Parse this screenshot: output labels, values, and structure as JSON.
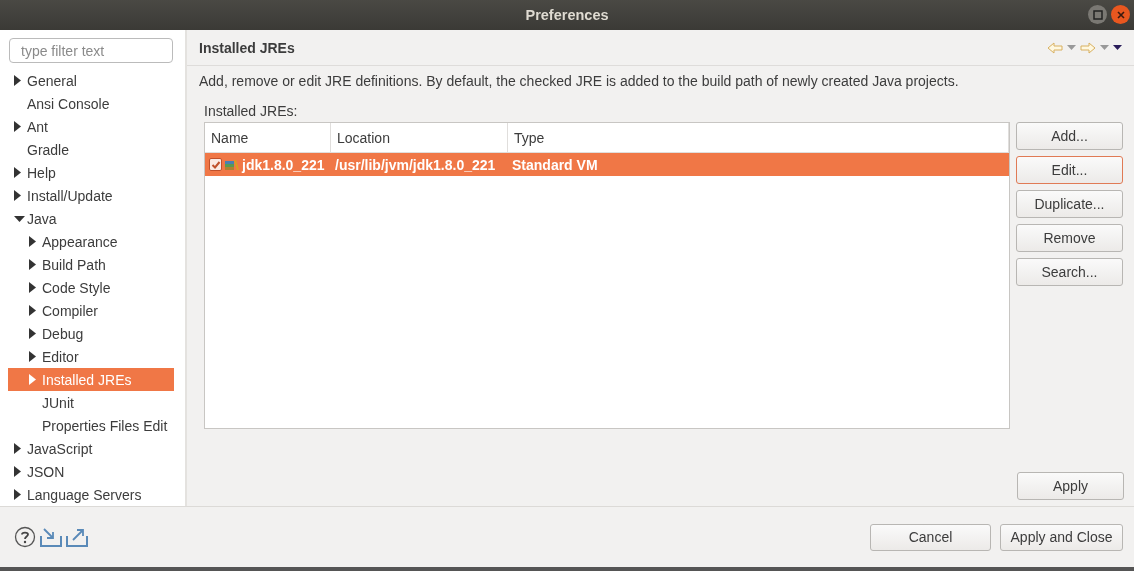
{
  "window": {
    "title": "Preferences"
  },
  "filter": {
    "placeholder": "type filter text"
  },
  "tree": [
    {
      "label": "General",
      "kind": "folder",
      "expanded": false,
      "selected": false
    },
    {
      "label": "Ansi Console",
      "kind": "leaf",
      "selected": false
    },
    {
      "label": "Ant",
      "kind": "folder",
      "expanded": false,
      "selected": false
    },
    {
      "label": "Gradle",
      "kind": "leaf",
      "selected": false
    },
    {
      "label": "Help",
      "kind": "folder",
      "expanded": false,
      "selected": false
    },
    {
      "label": "Install/Update",
      "kind": "folder",
      "expanded": false,
      "selected": false
    },
    {
      "label": "Java",
      "kind": "folder",
      "expanded": true,
      "selected": false,
      "children": [
        {
          "label": "Appearance",
          "kind": "folder",
          "expanded": false,
          "selected": false
        },
        {
          "label": "Build Path",
          "kind": "folder",
          "expanded": false,
          "selected": false
        },
        {
          "label": "Code Style",
          "kind": "folder",
          "expanded": false,
          "selected": false
        },
        {
          "label": "Compiler",
          "kind": "folder",
          "expanded": false,
          "selected": false
        },
        {
          "label": "Debug",
          "kind": "folder",
          "expanded": false,
          "selected": false
        },
        {
          "label": "Editor",
          "kind": "folder",
          "expanded": false,
          "selected": false
        },
        {
          "label": "Installed JREs",
          "kind": "folder",
          "expanded": false,
          "selected": true
        },
        {
          "label": "JUnit",
          "kind": "leaf",
          "selected": false
        },
        {
          "label": "Properties Files Edit",
          "kind": "leaf",
          "selected": false
        }
      ]
    },
    {
      "label": "JavaScript",
      "kind": "folder",
      "expanded": false,
      "selected": false
    },
    {
      "label": "JSON",
      "kind": "folder",
      "expanded": false,
      "selected": false
    },
    {
      "label": "Language Servers",
      "kind": "folder",
      "expanded": false,
      "selected": false
    }
  ],
  "page": {
    "title": "Installed JREs",
    "description": "Add, remove or edit JRE definitions. By default, the checked JRE is added to the build path of newly created Java projects.",
    "list_label": "Installed JREs:"
  },
  "table": {
    "columns": [
      "Name",
      "Location",
      "Type"
    ],
    "rows": [
      {
        "name": "jdk1.8.0_221",
        "location": "/usr/lib/jvm/jdk1.8.0_221",
        "type": "Standard VM",
        "checked": true,
        "selected": true
      }
    ]
  },
  "side_buttons": [
    {
      "label": "Add...",
      "focused": false
    },
    {
      "label": "Edit...",
      "focused": true
    },
    {
      "label": "Duplicate...",
      "focused": false
    },
    {
      "label": "Remove",
      "focused": false
    },
    {
      "label": "Search...",
      "focused": false
    }
  ],
  "apply": "Apply",
  "footer_buttons": [
    "Cancel",
    "Apply and Close"
  ]
}
